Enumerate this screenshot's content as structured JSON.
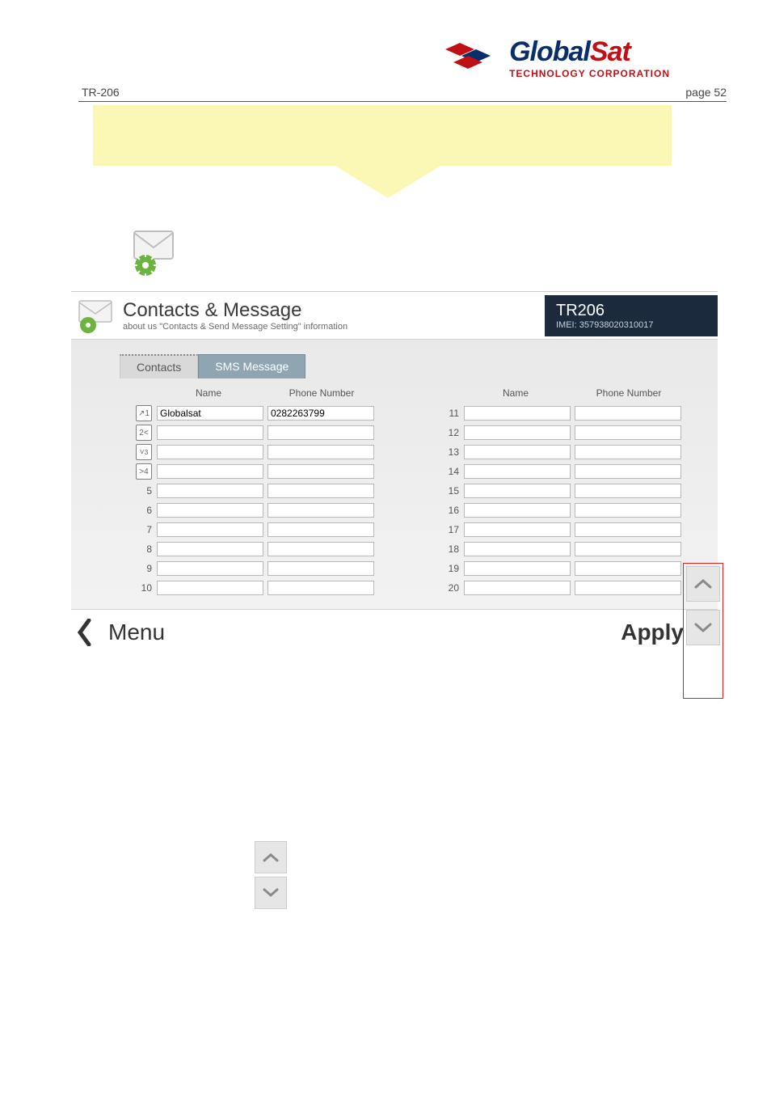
{
  "header": {
    "model_id": "TR-206",
    "page_label": "page 52"
  },
  "logo": {
    "brand_a": "Global",
    "brand_b": "Sat",
    "tagline": "TECHNOLOGY CORPORATION"
  },
  "app": {
    "title": "Contacts & Message",
    "subtitle": "about us \"Contacts & Send Message Setting\" information",
    "device_model": "TR206",
    "imei": "IMEI: 357938020310017",
    "tabs": {
      "contacts": "Contacts",
      "sms": "SMS Message"
    },
    "col_headers": {
      "name": "Name",
      "phone": "Phone Number"
    },
    "left": {
      "1": {
        "name": "Globalsat",
        "phone": "0282263799"
      },
      "2": {
        "name": "",
        "phone": ""
      },
      "3": {
        "name": "",
        "phone": ""
      },
      "4": {
        "name": "",
        "phone": ""
      },
      "5": {
        "name": "",
        "phone": ""
      },
      "6": {
        "name": "",
        "phone": ""
      },
      "7": {
        "name": "",
        "phone": ""
      },
      "8": {
        "name": "",
        "phone": ""
      },
      "9": {
        "name": "",
        "phone": ""
      },
      "10": {
        "name": "",
        "phone": ""
      }
    },
    "right": {
      "11": {
        "name": "",
        "phone": ""
      },
      "12": {
        "name": "",
        "phone": ""
      },
      "13": {
        "name": "",
        "phone": ""
      },
      "14": {
        "name": "",
        "phone": ""
      },
      "15": {
        "name": "",
        "phone": ""
      },
      "16": {
        "name": "",
        "phone": ""
      },
      "17": {
        "name": "",
        "phone": ""
      },
      "18": {
        "name": "",
        "phone": ""
      },
      "19": {
        "name": "",
        "phone": ""
      },
      "20": {
        "name": "",
        "phone": ""
      }
    },
    "footer": {
      "menu": "Menu",
      "apply": "Apply"
    }
  },
  "idx": {
    "l": [
      "1",
      "2",
      "3",
      "4",
      "5",
      "6",
      "7",
      "8",
      "9",
      "10"
    ],
    "r": [
      "11",
      "12",
      "13",
      "14",
      "15",
      "16",
      "17",
      "18",
      "19",
      "20"
    ]
  }
}
